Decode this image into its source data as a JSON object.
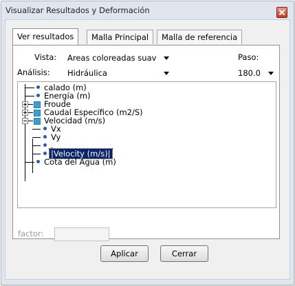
{
  "window": {
    "title": "Visualizar Resultados y Deformación"
  },
  "tabs": [
    {
      "label": "Ver resultados"
    },
    {
      "label": "Malla Principal"
    },
    {
      "label": "Malla de referencia"
    }
  ],
  "form": {
    "vista_label": "Vista:",
    "vista_value": "Areas coloreadas suav",
    "analisis_label": "Análisis:",
    "analisis_value": "Hidráulica",
    "paso_label": "Paso:",
    "paso_value": "180.0"
  },
  "tree": {
    "items": [
      "calado (m)",
      "Energía (m)",
      "Froude",
      "Caudal Específico (m2/S)",
      "Velocidad (m/s)",
      "Vx",
      "Vy",
      ".",
      "|Velocity (m/s)|",
      "Cota del Agua (m)"
    ],
    "selected_item": "|Velocity (m/s)|"
  },
  "factor": {
    "label": "factor:",
    "value": ""
  },
  "buttons": {
    "apply": "Aplicar",
    "close": "Cerrar"
  },
  "colors": {
    "selection": "#0a246a",
    "accent_bullet": "#2b5aa8",
    "folder_square": "#3aa0d0"
  }
}
